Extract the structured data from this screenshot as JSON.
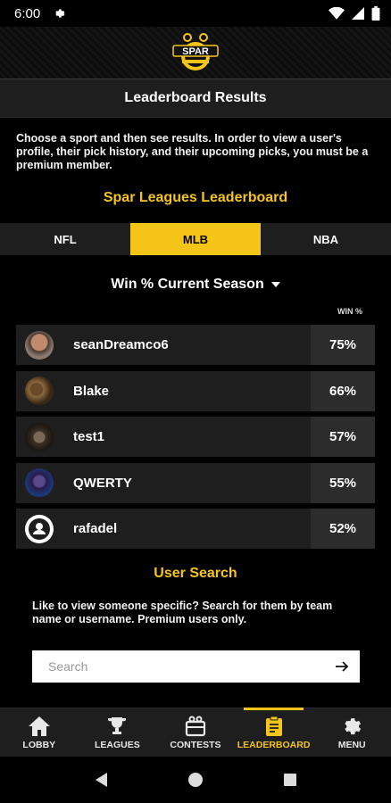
{
  "status": {
    "time": "6:00"
  },
  "header": {
    "title": "Leaderboard Results",
    "logo_text": "SPAR"
  },
  "intro_text": "Choose a sport and then see results. In order to view a user's profile, their pick history, and their upcoming picks, you must be a premium member.",
  "leaderboard_title": "Spar Leagues Leaderboard",
  "sport_tabs": [
    "NFL",
    "MLB",
    "NBA"
  ],
  "active_sport": "MLB",
  "season_select": "Win % Current Season",
  "column_header": "WIN %",
  "rows": [
    {
      "name": "seanDreamco6",
      "pct": "75%"
    },
    {
      "name": "Blake",
      "pct": "66%"
    },
    {
      "name": "test1",
      "pct": "57%"
    },
    {
      "name": "QWERTY",
      "pct": "55%"
    },
    {
      "name": "rafadel",
      "pct": "52%"
    }
  ],
  "user_search": {
    "title": "User Search",
    "description": "Like to view someone specific? Search for them by team name or username. Premium users only.",
    "placeholder": "Search"
  },
  "nav": [
    {
      "label": "LOBBY",
      "icon": "home-icon"
    },
    {
      "label": "LEAGUES",
      "icon": "trophy-icon"
    },
    {
      "label": "CONTESTS",
      "icon": "tickets-icon"
    },
    {
      "label": "LEADERBOARD",
      "icon": "clipboard-icon"
    },
    {
      "label": "MENU",
      "icon": "gear-icon"
    }
  ],
  "active_nav": "LEADERBOARD",
  "colors": {
    "accent": "#f5c518",
    "background": "#000000",
    "surface": "#1e1e1e"
  }
}
